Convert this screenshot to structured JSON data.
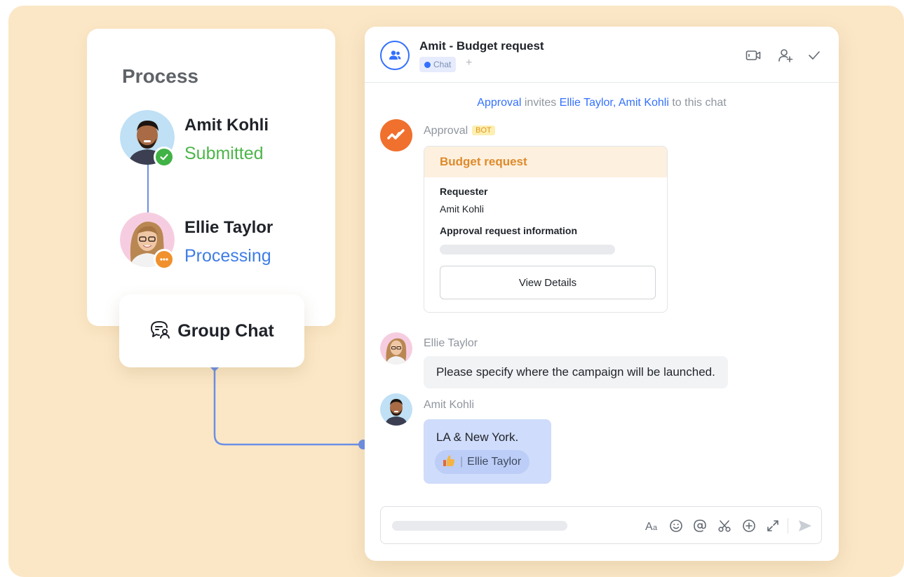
{
  "process": {
    "title": "Process",
    "people": [
      {
        "name": "Amit Kohli",
        "status": "Submitted",
        "avatar_icon": "amit-avatar",
        "status_icon": "check-icon",
        "status_color": "#4db54a"
      },
      {
        "name": "Ellie Taylor",
        "status": "Processing",
        "avatar_icon": "ellie-avatar",
        "status_icon": "more-icon",
        "status_color": "#3f7de6"
      }
    ],
    "group_chat_label": "Group Chat",
    "group_chat_icon": "group-chat-icon"
  },
  "chat": {
    "title": "Amit - Budget request",
    "tag": "Chat",
    "add_tab": "+",
    "header_icons": [
      "video-icon",
      "add-member-icon",
      "checkmark-icon"
    ],
    "system_message": {
      "actor": "Approval",
      "verb": " invites ",
      "invitee_1": "Ellie Taylor",
      "comma": ", ",
      "invitee_2": "Amit Kohli",
      "suffix": " to this chat"
    },
    "messages": [
      {
        "sender": "Approval",
        "badge": "BOT",
        "card": {
          "title": "Budget request",
          "requester_label": "Requester",
          "requester_value": "Amit Kohli",
          "info_label": "Approval request information",
          "button_label": "View Details"
        }
      },
      {
        "sender": "Ellie Taylor",
        "text": "Please specify where the campaign will be launched."
      },
      {
        "sender": "Amit Kohli",
        "text": "LA & New York.",
        "reaction": {
          "emoji_icon": "thumbs-up-icon",
          "separator": "|",
          "by": "Ellie Taylor"
        }
      }
    ],
    "composer": {
      "tools": [
        "font-icon",
        "emoji-icon",
        "mention-icon",
        "scissors-icon",
        "add-icon",
        "expand-icon"
      ],
      "send_icon": "send-icon"
    }
  },
  "colors": {
    "background": "#fbe7c6",
    "accent_blue": "#3370ff",
    "bot_orange": "#f0702e",
    "card_header": "#de8a2c"
  }
}
